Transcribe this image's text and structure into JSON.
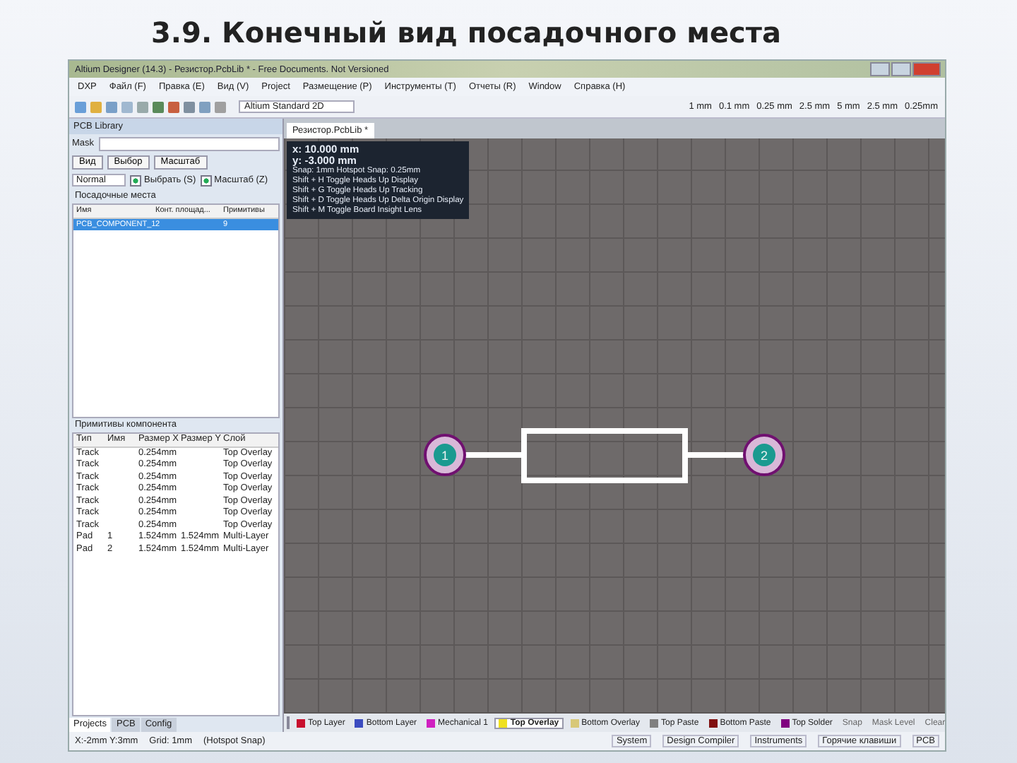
{
  "slide_title": "3.9. Конечный вид посадочного места",
  "window": {
    "title": "Altium Designer (14.3) - Резистор.PcbLib * - Free Documents. Not Versioned"
  },
  "menu": [
    "DXP",
    "Файл (F)",
    "Правка (E)",
    "Вид (V)",
    "Project",
    "Размещение (P)",
    "Инструменты (T)",
    "Отчеты (R)",
    "Window",
    "Справка (H)"
  ],
  "toolbar": {
    "view_select": "Altium Standard 2D",
    "grid_steps": [
      "1 mm",
      "0.1 mm",
      "0.25 mm",
      "2.5 mm",
      "5 mm",
      "2.5 mm",
      "0.25mm"
    ]
  },
  "panel": {
    "title": "PCB Library",
    "mask_label": "Mask",
    "buttons": [
      "Вид",
      "Выбор",
      "Масштаб"
    ],
    "mode": "Normal",
    "options": [
      {
        "label": "Выбрать (S)",
        "checked": true
      },
      {
        "label": "Масштаб (Z)",
        "checked": true
      }
    ],
    "footprints_title": "Посадочные места",
    "footprints_columns": [
      "Имя",
      "Конт. площад...",
      "Примитивы"
    ],
    "footprints": [
      {
        "cells": [
          "PCB_COMPONENT_1",
          "2",
          "9"
        ],
        "selected": true
      }
    ],
    "primitives_title": "Примитивы компонента",
    "primitives_columns": [
      "Тип",
      "Имя",
      "Размер X",
      "Размер Y",
      "Слой"
    ],
    "primitives": [
      {
        "cells": [
          "Track",
          "",
          "0.254mm",
          "",
          "Top Overlay"
        ]
      },
      {
        "cells": [
          "Track",
          "",
          "0.254mm",
          "",
          "Top Overlay"
        ]
      },
      {
        "cells": [
          "Track",
          "",
          "0.254mm",
          "",
          "Top Overlay"
        ]
      },
      {
        "cells": [
          "Track",
          "",
          "0.254mm",
          "",
          "Top Overlay"
        ]
      },
      {
        "cells": [
          "Track",
          "",
          "0.254mm",
          "",
          "Top Overlay"
        ]
      },
      {
        "cells": [
          "Track",
          "",
          "0.254mm",
          "",
          "Top Overlay"
        ]
      },
      {
        "cells": [
          "Track",
          "",
          "0.254mm",
          "",
          "Top Overlay"
        ]
      },
      {
        "cells": [
          "Pad",
          "1",
          "1.524mm",
          "1.524mm",
          "Multi-Layer"
        ]
      },
      {
        "cells": [
          "Pad",
          "2",
          "1.524mm",
          "1.524mm",
          "Multi-Layer"
        ]
      }
    ],
    "tabs": [
      {
        "label": "Projects",
        "selected": true
      },
      {
        "label": "PCB",
        "selected": false
      },
      {
        "label": "Config",
        "selected": false
      }
    ]
  },
  "document_tab": {
    "label": "Резистор.PcbLib *",
    "selected": true
  },
  "heads_up": [
    "x: 10.000 mm",
    "y: -3.000 mm",
    "Snap: 1mm Hotspot Snap: 0.25mm",
    "Shift + H  Toggle Heads Up Display",
    "Shift + G  Toggle Heads Up Tracking",
    "Shift + D  Toggle Heads Up Delta Origin Display",
    "Shift + M  Toggle Board Insight Lens"
  ],
  "pads": [
    "1",
    "2"
  ],
  "layers": [
    {
      "label": "Top Layer",
      "color": "#c8102e",
      "selected": false
    },
    {
      "label": "Bottom Layer",
      "color": "#3b4cc0",
      "selected": false
    },
    {
      "label": "Mechanical 1",
      "color": "#d020c0",
      "selected": false
    },
    {
      "label": "Top Overlay",
      "color": "#f0e020",
      "selected": true
    },
    {
      "label": "Bottom Overlay",
      "color": "#d8c878",
      "selected": false
    },
    {
      "label": "Top Paste",
      "color": "#808080",
      "selected": false
    },
    {
      "label": "Bottom Paste",
      "color": "#801010",
      "selected": false
    },
    {
      "label": "Top Solder",
      "color": "#800080",
      "selected": false
    }
  ],
  "layer_buttons": [
    "Snap",
    "Mask Level",
    "Clear"
  ],
  "status": {
    "left": [
      "X:-2mm Y:3mm",
      "Grid: 1mm",
      "(Hotspot Snap)"
    ],
    "right": [
      "System",
      "Design Compiler",
      "Instruments",
      "Горячие клавиши",
      "PCB"
    ]
  }
}
